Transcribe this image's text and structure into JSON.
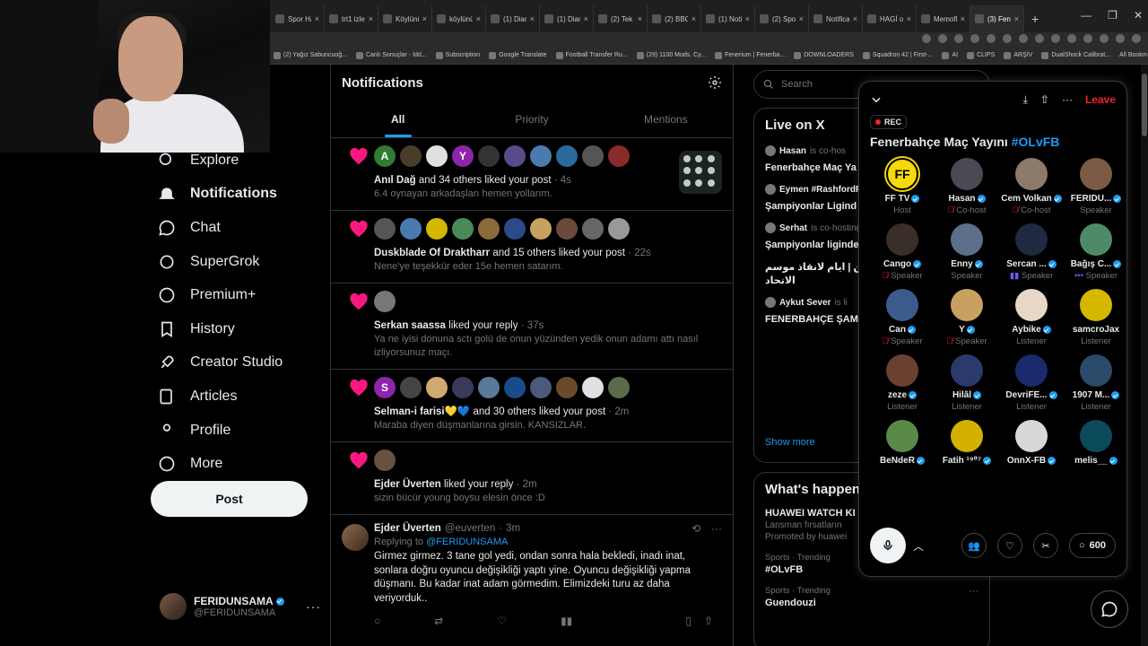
{
  "browser": {
    "tabs": [
      {
        "label": "Spor Hab"
      },
      {
        "label": "trt1 izle"
      },
      {
        "label": "Köylünün"
      },
      {
        "label": "köylünün"
      },
      {
        "label": "(1) Diam"
      },
      {
        "label": "(1) Diam"
      },
      {
        "label": "(2) Tek Y"
      },
      {
        "label": "(2) BBO"
      },
      {
        "label": "(1) Notifi"
      },
      {
        "label": "(2) Spor"
      },
      {
        "label": "Notificat"
      },
      {
        "label": "HAGİ on"
      },
      {
        "label": "Memofli"
      },
      {
        "label": "(3) Fene"
      }
    ],
    "bookmarks": [
      "(2) Yağız Sabuncuoğ...",
      "Canlı Sonuçlar - İdd...",
      "Subscription",
      "Google Translate",
      "Football Transfer Ru...",
      "(29) 1100 Mods. Cy...",
      "Fenerium | Fenerba...",
      "DOWNLOADERS",
      "Squadron 42 | First-...",
      "AI",
      "CLIPS",
      "ARŞİV",
      "DualShock Calibrat..."
    ],
    "all_bookmarks": "All Bookmarks"
  },
  "nav": {
    "items": [
      {
        "label": "Explore",
        "icon": "search-icon"
      },
      {
        "label": "Notifications",
        "icon": "bell-icon"
      },
      {
        "label": "Chat",
        "icon": "chat-icon"
      },
      {
        "label": "SuperGrok",
        "icon": "grok-icon"
      },
      {
        "label": "Premium+",
        "icon": "verified-icon"
      },
      {
        "label": "History",
        "icon": "bookmark-icon"
      },
      {
        "label": "Creator Studio",
        "icon": "rocket-icon"
      },
      {
        "label": "Articles",
        "icon": "article-icon"
      },
      {
        "label": "Profile",
        "icon": "person-icon"
      },
      {
        "label": "More",
        "icon": "more-circle-icon"
      }
    ],
    "post_label": "Post"
  },
  "account": {
    "name": "FERIDUNSAMA",
    "handle": "@FERIDUNSAMA"
  },
  "center": {
    "title": "Notifications",
    "tabs": [
      "All",
      "Priority",
      "Mentions"
    ],
    "notifications": [
      {
        "name": "Anıl Dağ",
        "action": "and 34 others liked your post",
        "time": "4s",
        "text": "6.4 oynayan arkadaşları hemen yollarım."
      },
      {
        "name": "Duskblade Of Draktharr",
        "action": "and 15 others liked your post",
        "time": "22s",
        "text": "Nene'ye teşekkür eder 15e hemen satarım."
      },
      {
        "name": "Serkan saassa",
        "action": "liked your reply",
        "time": "37s",
        "text": "Ya ne iyisi donuna sctı golü de onun yüzünden yedik onun adamı attı nasıl izliyorsunuz maçı."
      },
      {
        "name": "Selman-i farisi💛💙",
        "action": "and 30 others liked your post",
        "time": "2m",
        "text": "Maraba diyen düşmanlarına girsin. KANSIZLAR."
      },
      {
        "name": "Ejder Üverten",
        "action": "liked your reply",
        "time": "2m",
        "text": "sizin bücür young boysu elesin önce :D"
      }
    ],
    "reply": {
      "name": "Ejder Üverten",
      "handle": "@euverten",
      "time": "3m",
      "replying_to_label": "Replying to",
      "replying_to": "@FERIDUNSAMA",
      "text": "Girmez girmez. 3 tane gol yedi, ondan sonra hala bekledi, inadı inat, sonlara doğru oyuncu değişikliği yaptı yine. Oyuncu değişikliği yapma düşmanı. Bu kadar inat adam görmedim. Elimizdeki turu az daha veriyorduk.."
    }
  },
  "right": {
    "search_placeholder": "Search",
    "live_title": "Live on X",
    "live": [
      {
        "host": "Hasan",
        "role": "is co-hos",
        "title": "Fenerbahçe Maç Ya #OLvFB"
      },
      {
        "host": "Eymen #RashfordF",
        "role": "",
        "title": "Şampiyonlar Ligind 💛💙"
      },
      {
        "host": "Serhat",
        "role": "is co-hosting",
        "title": "Şampiyonlar liginde 💛💙"
      },
      {
        "host": "",
        "role": "",
        "title": "عزيز لا لعودة المنتهين | ايام لانقاذ موسم الاتحاد"
      },
      {
        "host": "Aykut Sever",
        "role": "is li",
        "title": "FENERBAHÇE ŞAMPİYONLAR LİG"
      }
    ],
    "show_more": "Show more",
    "happening_title": "What's happen",
    "trends": [
      {
        "meta": "",
        "name": "HUAWEI WATCH KI",
        "sub": "Lansman fırsatların",
        "promo": "Promoted by huawei"
      },
      {
        "meta": "Sports · Trending",
        "name": "#OLvFB",
        "sub": "",
        "promo": ""
      },
      {
        "meta": "Sports · Trending",
        "name": "Guendouzi",
        "sub": "",
        "promo": ""
      }
    ]
  },
  "space": {
    "leave_label": "Leave",
    "rec_label": "REC",
    "title": "Fenerbahçe Maç Yayını",
    "hashtag": "#OLvFB",
    "participants": [
      {
        "name": "FF TV",
        "role": "Host",
        "verified": true,
        "muted": false,
        "color": "#f5d90a"
      },
      {
        "name": "Hasan",
        "role": "Co-host",
        "verified": true,
        "muted": true,
        "color": "#4a4a55"
      },
      {
        "name": "Cem Volkan",
        "role": "Co-host",
        "verified": true,
        "muted": true,
        "color": "#8c7a6a"
      },
      {
        "name": "FERIDU...",
        "role": "Speaker",
        "verified": true,
        "muted": false,
        "color": "#7b5a46"
      },
      {
        "name": "Cango",
        "role": "Speaker",
        "verified": true,
        "muted": true,
        "color": "#3a2e28"
      },
      {
        "name": "Enny",
        "role": "Speaker",
        "verified": true,
        "muted": false,
        "color": "#5d6e8a"
      },
      {
        "name": "Sercan ...",
        "role": "Speaker",
        "verified": true,
        "muted": false,
        "speaking": true,
        "color": "#1f2a40"
      },
      {
        "name": "Bağış C...",
        "role": "Speaker",
        "verified": true,
        "muted": false,
        "dots": true,
        "color": "#4e8a6a"
      },
      {
        "name": "Can",
        "role": "Speaker",
        "verified": true,
        "muted": true,
        "color": "#3b5b8c"
      },
      {
        "name": "Y",
        "role": "Speaker",
        "verified": true,
        "muted": true,
        "color": "#c8a060"
      },
      {
        "name": "Aybike",
        "role": "Listener",
        "verified": true,
        "muted": false,
        "color": "#e8d8c8"
      },
      {
        "name": "samcroJax",
        "role": "Listener",
        "verified": false,
        "muted": false,
        "color": "#d4b800"
      },
      {
        "name": "zeze",
        "role": "Listener",
        "verified": true,
        "muted": false,
        "color": "#6a4030"
      },
      {
        "name": "Hilâl",
        "role": "Listener",
        "verified": true,
        "muted": false,
        "color": "#2a3a6a"
      },
      {
        "name": "DevriFE...",
        "role": "Listener",
        "verified": true,
        "muted": false,
        "color": "#1a2a6a"
      },
      {
        "name": "1907 M...",
        "role": "Listener",
        "verified": true,
        "muted": false,
        "color": "#2a4a6a"
      },
      {
        "name": "BeNdeR",
        "role": "",
        "verified": true,
        "muted": false,
        "color": "#5a8a4a"
      },
      {
        "name": "Fatih ¹⁹⁰⁷",
        "role": "",
        "verified": true,
        "muted": false,
        "color": "#d4b000"
      },
      {
        "name": "OnnX-FB",
        "role": "",
        "verified": true,
        "muted": false,
        "color": "#d8d8d8"
      },
      {
        "name": "melis__",
        "role": "",
        "verified": true,
        "muted": false,
        "color": "#0a4a5a"
      }
    ],
    "count": "600"
  },
  "colors": {
    "accent": "#1d9bf0",
    "like": "#f91880",
    "danger": "#f4212e"
  }
}
